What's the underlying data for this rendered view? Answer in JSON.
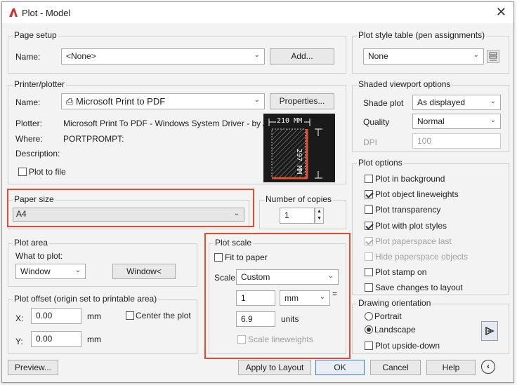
{
  "window": {
    "title": "Plot - Model",
    "close_glyph": "✕"
  },
  "page_setup": {
    "group_label": "Page setup",
    "name_label": "Name:",
    "name_value": "<None>",
    "add_button": "Add..."
  },
  "printer": {
    "group_label": "Printer/plotter",
    "name_label": "Name:",
    "name_value": "Microsoft Print to PDF",
    "properties_button": "Properties...",
    "plotter_label": "Plotter:",
    "plotter_value": "Microsoft Print To PDF - Windows System Driver - by Au...",
    "where_label": "Where:",
    "where_value": "PORTPROMPT:",
    "description_label": "Description:",
    "plot_to_file": "Plot to file",
    "preview_width": "210 MM",
    "preview_height": "297 MM"
  },
  "paper_size": {
    "group_label": "Paper size",
    "value": "A4"
  },
  "copies": {
    "label": "Number of copies",
    "value": "1"
  },
  "plot_area": {
    "group_label": "Plot area",
    "what_label": "What to plot:",
    "what_value": "Window",
    "window_button": "Window<"
  },
  "plot_offset": {
    "group_label": "Plot offset (origin set to printable area)",
    "x_label": "X:",
    "x_value": "0.00",
    "x_unit": "mm",
    "y_label": "Y:",
    "y_value": "0.00",
    "y_unit": "mm",
    "center": "Center the plot"
  },
  "plot_scale": {
    "group_label": "Plot scale",
    "fit": "Fit to paper",
    "scale_label": "Scale:",
    "scale_value": "Custom",
    "value1": "1",
    "unit1": "mm",
    "equals": "=",
    "value2": "6.9",
    "unit2": "units",
    "lineweights": "Scale lineweights"
  },
  "plot_style": {
    "group_label": "Plot style table (pen assignments)",
    "value": "None"
  },
  "shaded": {
    "group_label": "Shaded viewport options",
    "shade_label": "Shade plot",
    "shade_value": "As displayed",
    "quality_label": "Quality",
    "quality_value": "Normal",
    "dpi_label": "DPI",
    "dpi_value": "100"
  },
  "plot_options": {
    "group_label": "Plot options",
    "items": [
      {
        "label": "Plot in background",
        "checked": false,
        "disabled": false
      },
      {
        "label": "Plot object lineweights",
        "checked": true,
        "disabled": false
      },
      {
        "label": "Plot transparency",
        "checked": false,
        "disabled": false
      },
      {
        "label": "Plot with plot styles",
        "checked": true,
        "disabled": false
      },
      {
        "label": "Plot paperspace last",
        "checked": true,
        "disabled": true
      },
      {
        "label": "Hide paperspace objects",
        "checked": false,
        "disabled": true
      },
      {
        "label": "Plot stamp on",
        "checked": false,
        "disabled": false
      },
      {
        "label": "Save changes to layout",
        "checked": false,
        "disabled": false
      }
    ]
  },
  "orientation": {
    "group_label": "Drawing orientation",
    "portrait": "Portrait",
    "landscape": "Landscape",
    "upside_down": "Plot upside-down",
    "selected": "Landscape"
  },
  "footer": {
    "preview": "Preview...",
    "apply": "Apply to Layout",
    "ok": "OK",
    "cancel": "Cancel",
    "help": "Help"
  },
  "colors": {
    "accent_red": "#e34d2e",
    "preview_bg": "#1a1a1a"
  }
}
